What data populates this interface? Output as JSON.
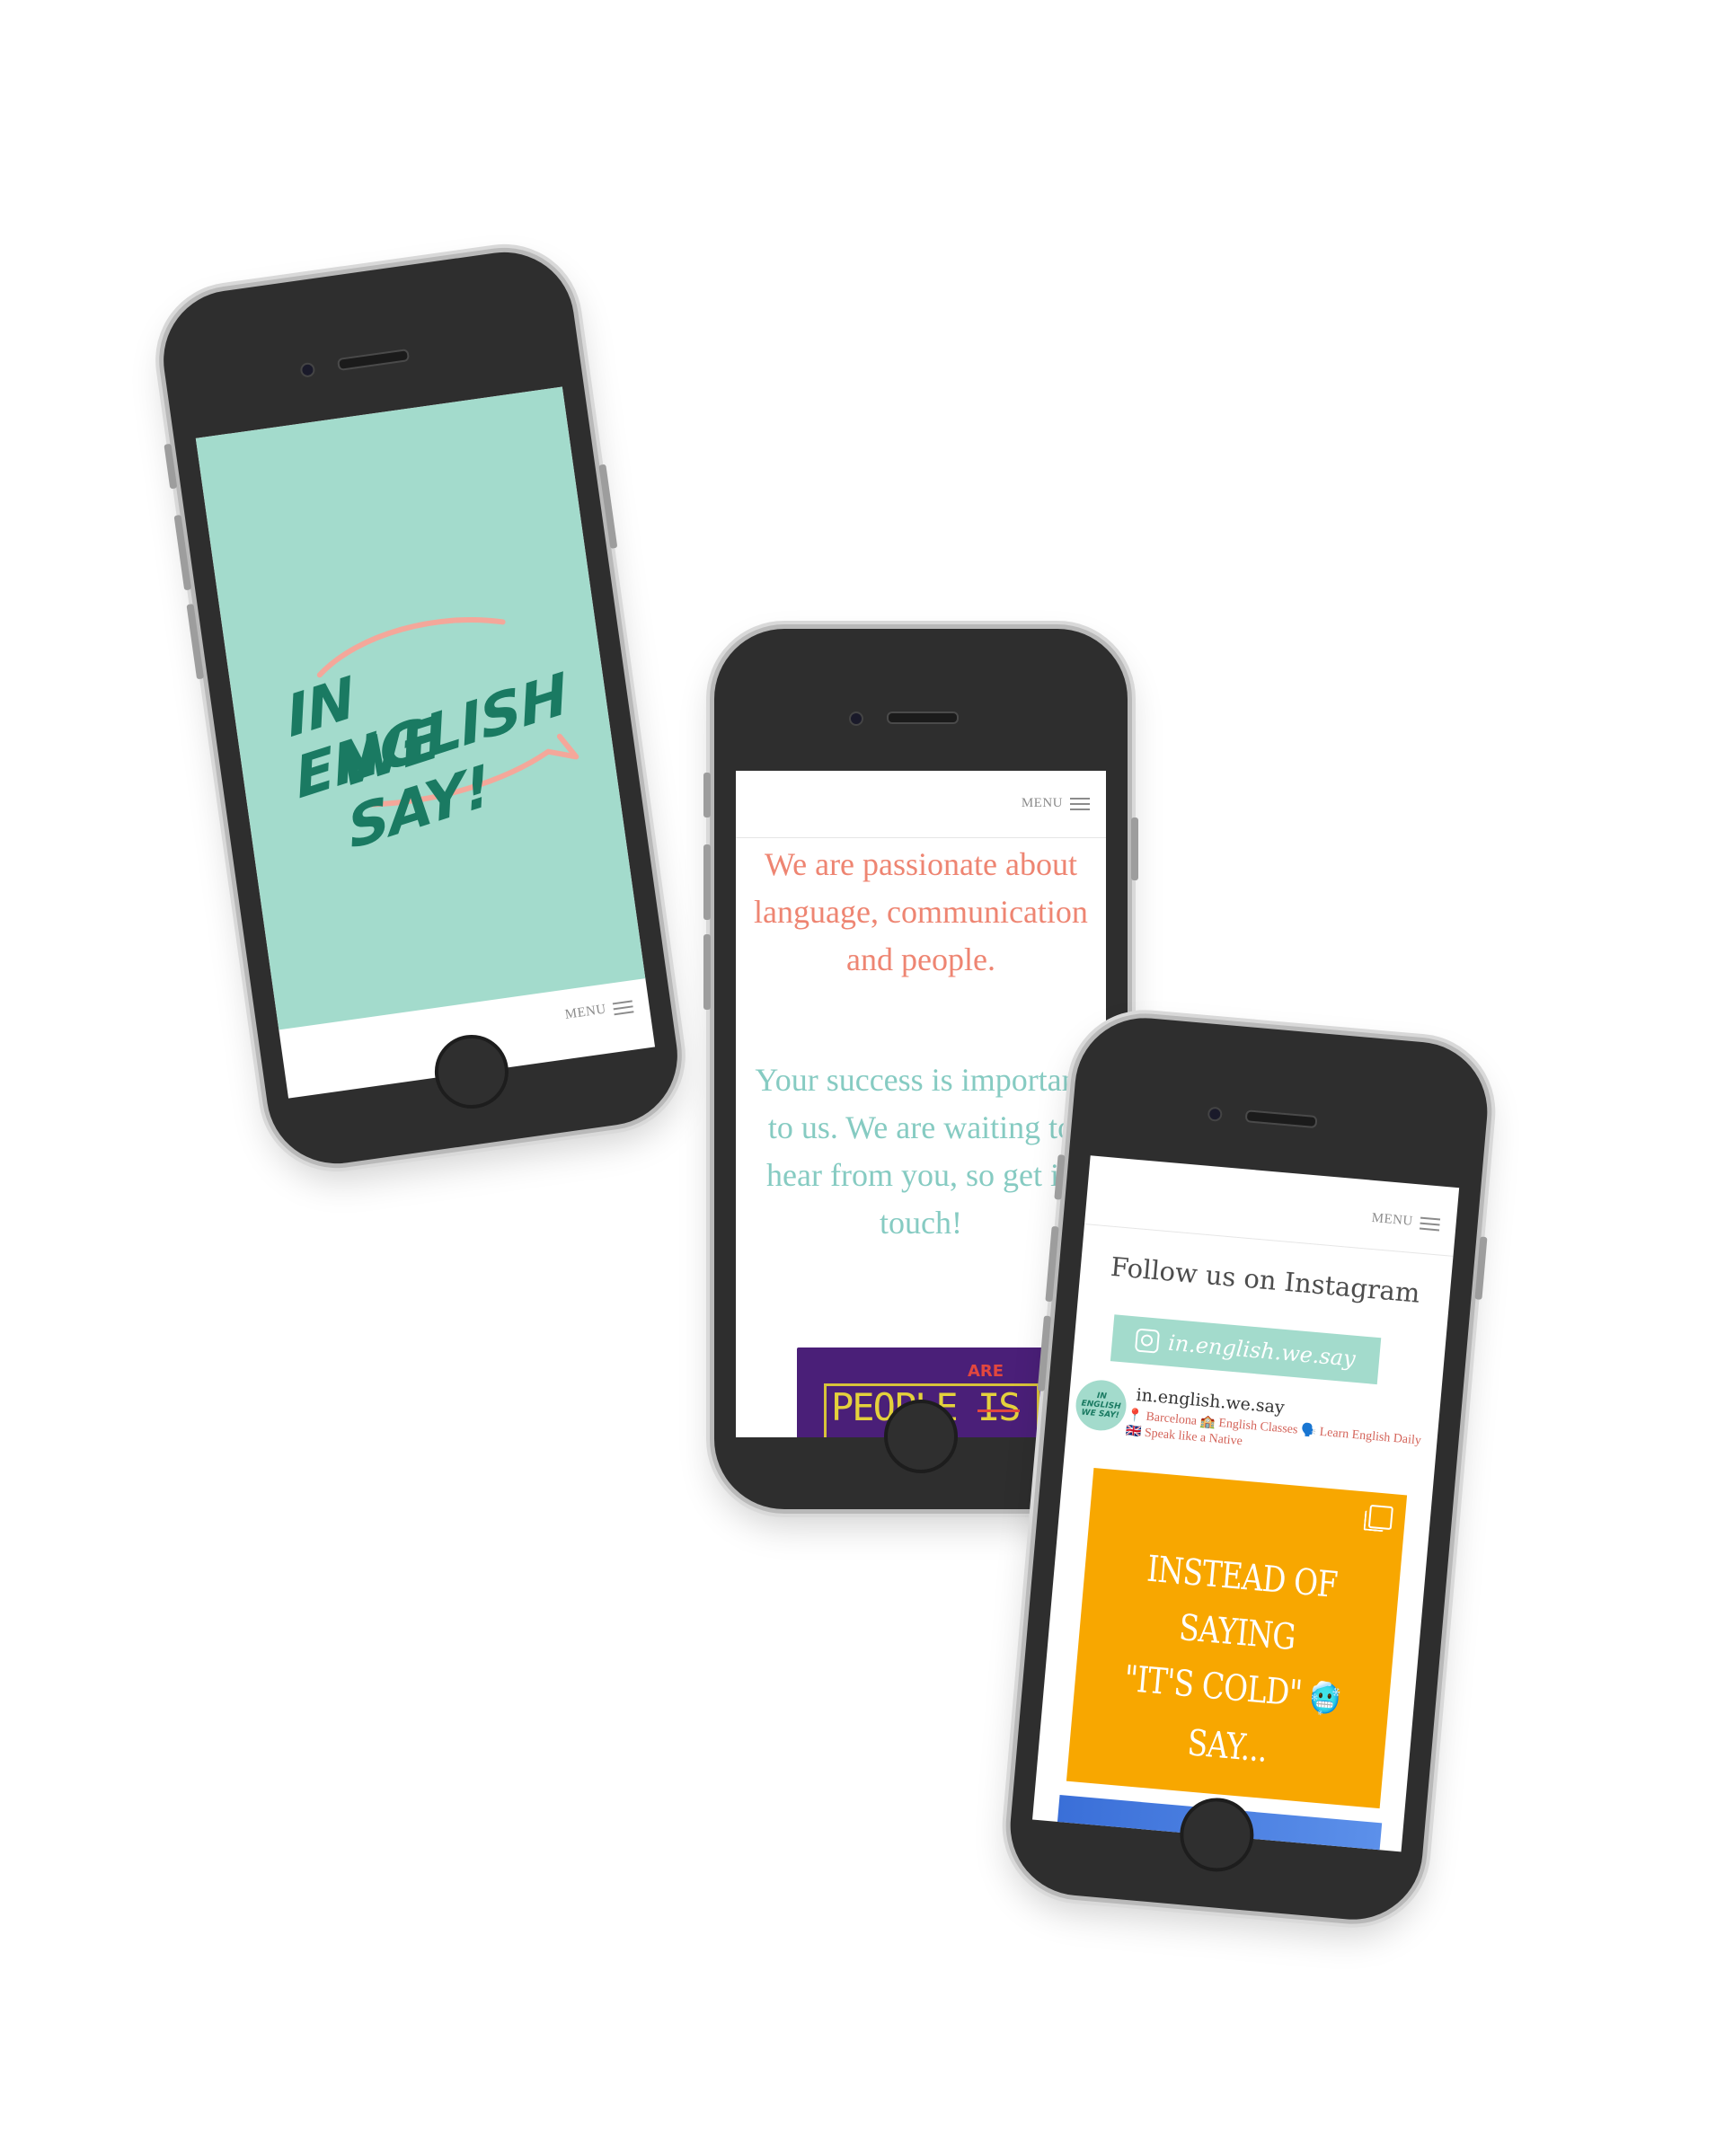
{
  "phone1": {
    "logo_line1": "IN ENGLISH",
    "logo_line2": "WE SAY!",
    "menu_label": "MENU",
    "colors": {
      "hero_bg": "#a3dbcc",
      "logo": "#1a7a62",
      "accent": "#f4a79a"
    }
  },
  "phone2": {
    "menu_label": "MENU",
    "passion_text": "We are passionate about language, communication and people.",
    "success_text": "Your success is important to us. We are waiting to hear from you, so get in touch!",
    "image": {
      "word": "PEOPLE",
      "crossed": "IS",
      "correction": "ARE"
    },
    "colors": {
      "coral": "#ee8572",
      "teal": "#86cbc2",
      "image_bg": "#4a1f78"
    }
  },
  "phone3": {
    "menu_label": "MENU",
    "section_title": "Follow us on Instagram",
    "handle_button": "in.english.we.say",
    "profile": {
      "avatar_text": "IN ENGLISH WE SAY!",
      "name": "in.english.we.say",
      "bio": "📍 Barcelona 🏫 English Classes 🗣️ Learn English Daily 🇬🇧 Speak like a Native"
    },
    "post": {
      "line1": "INSTEAD OF SAYING",
      "line2": "\"IT'S COLD\"",
      "line2_emoji": "🥶",
      "line3": "SAY..."
    },
    "icons": [
      "hamburger-icon",
      "instagram-icon",
      "multiple-posts-icon"
    ],
    "colors": {
      "button_bg": "#a3dbcc",
      "post_bg": "#f8a700",
      "bio": "#d4645a"
    }
  }
}
